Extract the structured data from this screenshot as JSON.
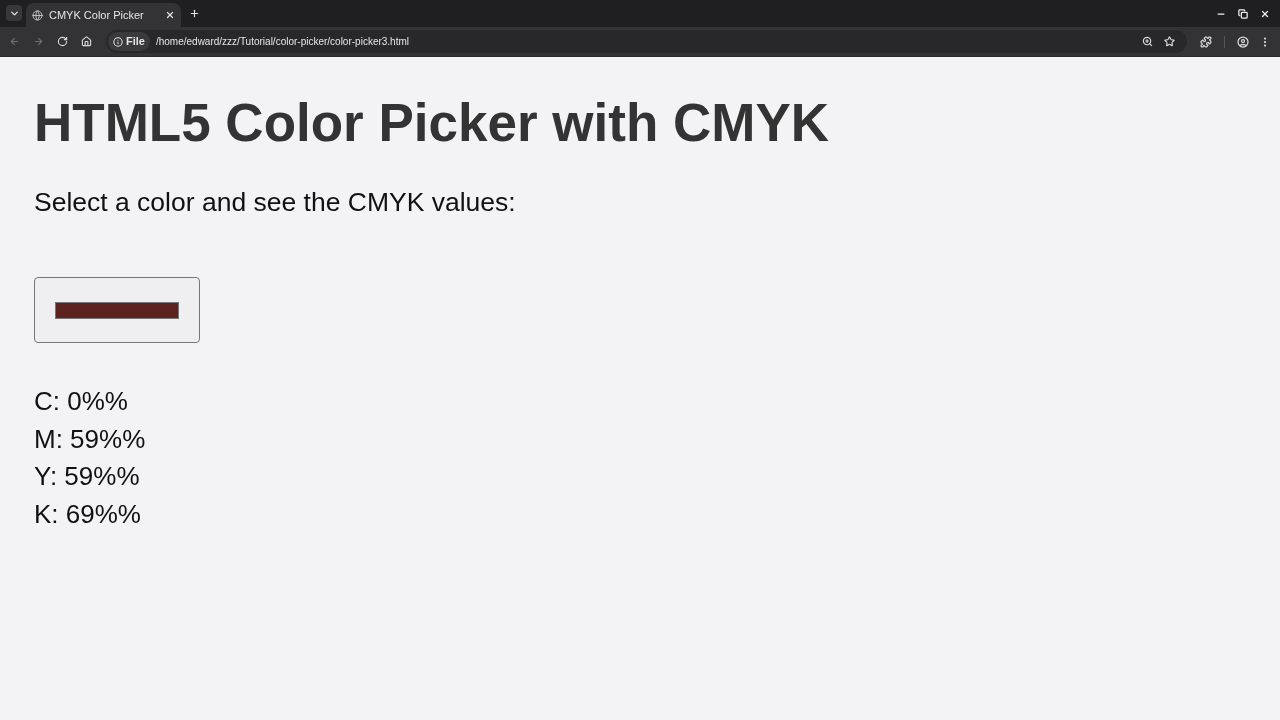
{
  "browser": {
    "tab": {
      "title": "CMYK Color Picker",
      "selected": true
    },
    "address": {
      "chip": "File",
      "url": "/home/edward/zzz/Tutorial/color-picker/color-picker3.html"
    }
  },
  "page": {
    "heading": "HTML5 Color Picker with CMYK",
    "intro": "Select a color and see the CMYK values:",
    "color_input": {
      "color": "#5b221f"
    },
    "values": [
      "C: 0%%",
      "M: 59%%",
      "Y: 59%%",
      "K: 69%%"
    ]
  }
}
